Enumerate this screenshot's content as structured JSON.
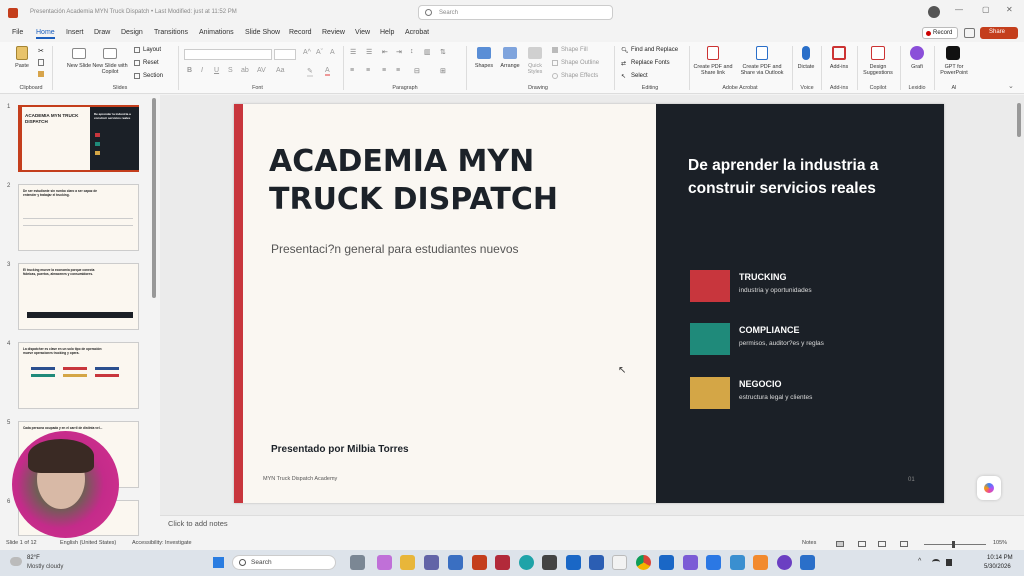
{
  "titlebar": {
    "title": "Presentación Academia MYN Truck Dispatch • Last Modified: just at 11:52 PM",
    "search_placeholder": "Search",
    "record": "Record",
    "share": "Share"
  },
  "tabs": [
    "File",
    "Home",
    "Insert",
    "Draw",
    "Design",
    "Transitions",
    "Animations",
    "Slide Show",
    "Record",
    "Review",
    "View",
    "Help",
    "Acrobat"
  ],
  "ribbon": {
    "paste": "Paste",
    "new_slide": "New Slide",
    "new_slide_copilot": "New Slide with Copilot",
    "layout": "Layout",
    "reset": "Reset",
    "section": "Section",
    "shapes": "Shapes",
    "arrange": "Arrange",
    "quick_styles": "Quick Styles",
    "shape_fill": "Shape Fill",
    "shape_outline": "Shape Outline",
    "shape_effects": "Shape Effects",
    "find_replace": "Find and Replace",
    "replace_fonts": "Replace Fonts",
    "select": "Select",
    "create_pdf_share": "Create PDF and Share link",
    "create_pdf_outlook": "Create PDF and Share via Outlook",
    "dictate": "Dictate",
    "addins": "Add-ins",
    "design_suggestions": "Design Suggestions",
    "grafi": "Grafi",
    "gpt": "GPT for PowerPoint",
    "groups": {
      "clipboard": "Clipboard",
      "slides": "Slides",
      "font": "Font",
      "paragraph": "Paragraph",
      "drawing": "Drawing",
      "editing": "Editing",
      "adobe": "Adobe Acrobat",
      "voice": "Voice",
      "addins": "Add-ins",
      "copilot": "Copilot",
      "lexidio": "Lexidio",
      "ai": "AI"
    }
  },
  "thumbnails": [
    {
      "num": "1",
      "title": "ACADEMIA MYN TRUCK DISPATCH",
      "subtitle": "De aprender la industria a construir servicios reales"
    },
    {
      "num": "2",
      "title": "De ser estudiante sin rumbo claro a ser capaz de entender y trabajar el trucking."
    },
    {
      "num": "3",
      "title": "El trucking mueve la economía porque conecta fábricas, puertos, almacenes y consumidores."
    },
    {
      "num": "4",
      "title": "La dispatcher es clave en un solo tipo de operación: mueve operaciones trucking y opera."
    },
    {
      "num": "5",
      "title": "Cada persona ocupada y en el carril de distinta vel..."
    },
    {
      "num": "6",
      "title": ""
    }
  ],
  "slide": {
    "title_line1": "ACADEMIA MYN",
    "title_line2": "TRUCK DISPATCH",
    "subtitle": "Presentaci?n general para estudiantes nuevos",
    "presenter": "Presentado por Milbia Torres",
    "footer": "MYN Truck Dispatch Academy",
    "page": "01",
    "right_title": "De aprender la industria a construir servicios reales",
    "items": [
      {
        "label": "TRUCKING",
        "desc": "industria y oportunidades",
        "color": "#c8363d"
      },
      {
        "label": "COMPLIANCE",
        "desc": "permisos, auditor?es y reglas",
        "color": "#1f8a7a"
      },
      {
        "label": "NEGOCIO",
        "desc": "estructura legal y clientes",
        "color": "#d4a646"
      }
    ]
  },
  "notes_placeholder": "Click to add notes",
  "status": {
    "slide": "Slide 1 of 12",
    "language": "English (United States)",
    "accessibility": "Accessibility: Investigate",
    "notes": "Notes",
    "zoom": "105%"
  },
  "taskbar": {
    "weather_temp": "82°F",
    "weather_desc": "Mostly cloudy",
    "search": "Search",
    "time": "10:14 PM",
    "date": "5/30/2026"
  }
}
